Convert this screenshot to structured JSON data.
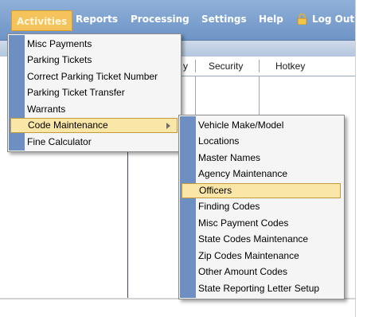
{
  "menubar": {
    "items": [
      {
        "label": "Activities"
      },
      {
        "label": "Reports"
      },
      {
        "label": "Processing"
      },
      {
        "label": "Settings"
      },
      {
        "label": "Help"
      },
      {
        "label": "Log Out",
        "icon": "lock-icon"
      }
    ]
  },
  "grid": {
    "columns": [
      "y",
      "Security",
      "Hotkey"
    ]
  },
  "activities_menu": {
    "items": [
      {
        "label": "Misc Payments"
      },
      {
        "label": "Parking Tickets"
      },
      {
        "label": "Correct Parking Ticket Number"
      },
      {
        "label": "Parking Ticket Transfer"
      },
      {
        "label": "Warrants"
      },
      {
        "label": "Code Maintenance",
        "has_submenu": true,
        "highlighted": true
      },
      {
        "label": "Fine Calculator"
      }
    ]
  },
  "code_maintenance_menu": {
    "items": [
      {
        "label": "Vehicle Make/Model"
      },
      {
        "label": "Locations"
      },
      {
        "label": "Master Names"
      },
      {
        "label": "Agency Maintenance"
      },
      {
        "label": "Officers",
        "highlighted": true
      },
      {
        "label": "Finding Codes"
      },
      {
        "label": "Misc Payment Codes"
      },
      {
        "label": "State Codes Maintenance"
      },
      {
        "label": "Zip Codes Maintenance"
      },
      {
        "label": "Other Amount Codes"
      },
      {
        "label": "State Reporting Letter Setup"
      }
    ]
  },
  "colors": {
    "menubar": "#7a9fce",
    "active_tab": "#f5c35b",
    "menu_gutter": "#6e8fc2",
    "highlight": "#fae6a6"
  }
}
